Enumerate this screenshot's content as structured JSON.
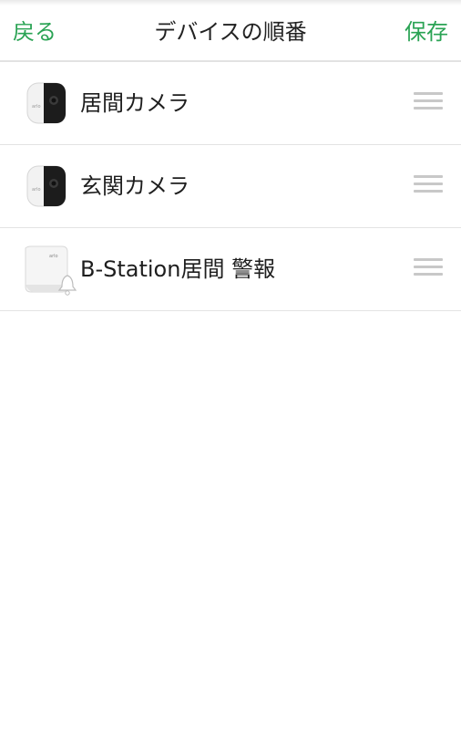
{
  "header": {
    "back_label": "戻る",
    "title": "デバイスの順番",
    "save_label": "保存",
    "accent_color": "#2aa354"
  },
  "devices": [
    {
      "label": "居間カメラ",
      "icon": "camera-icon"
    },
    {
      "label": "玄関カメラ",
      "icon": "camera-icon"
    },
    {
      "label": "B-Station居間 警報",
      "icon": "base-station-alarm-icon"
    }
  ]
}
